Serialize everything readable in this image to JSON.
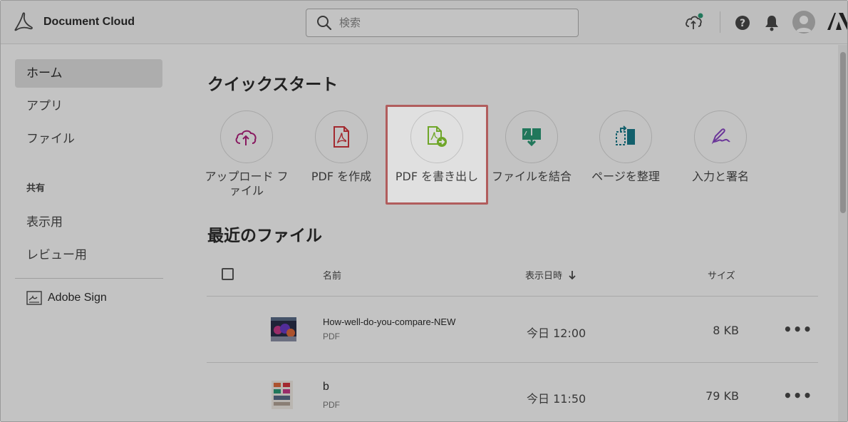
{
  "app": {
    "title": "Document Cloud"
  },
  "search": {
    "placeholder": "検索"
  },
  "sidebar": {
    "items": [
      {
        "label": "ホーム",
        "active": true
      },
      {
        "label": "アプリ"
      },
      {
        "label": "ファイル"
      }
    ],
    "shared_heading": "共有",
    "shared_items": [
      {
        "label": "表示用"
      },
      {
        "label": "レビュー用"
      }
    ],
    "sign": {
      "label": "Adobe Sign"
    }
  },
  "quickstart": {
    "title": "クイックスタート",
    "items": [
      {
        "label": "アップロード ファイル",
        "icon": "cloud-upload-icon",
        "color": "#b3217f"
      },
      {
        "label": "PDF を作成",
        "icon": "create-pdf-icon",
        "color": "#d7373f"
      },
      {
        "label": "PDF を書き出し",
        "icon": "export-pdf-icon",
        "color": "#7fbe2f"
      },
      {
        "label": "ファイルを結合",
        "icon": "combine-files-icon",
        "color": "#2d9d78"
      },
      {
        "label": "ページを整理",
        "icon": "organize-pages-icon",
        "color": "#1a7f8e"
      },
      {
        "label": "入力と署名",
        "icon": "fill-sign-icon",
        "color": "#8d48c9"
      }
    ]
  },
  "recent": {
    "title": "最近のファイル",
    "columns": {
      "name": "名前",
      "date": "表示日時",
      "size": "サイズ"
    },
    "rows": [
      {
        "name": "How-well-do-you-compare-NEW",
        "type": "PDF",
        "date": "今日 12:00",
        "size": "8 KB",
        "more": "•••"
      },
      {
        "name": "b",
        "type": "PDF",
        "date": "今日 11:50",
        "size": "79 KB",
        "more": "•••"
      }
    ]
  },
  "colors": {
    "accent": "#e97a7a",
    "brand": "#fa0f00"
  }
}
